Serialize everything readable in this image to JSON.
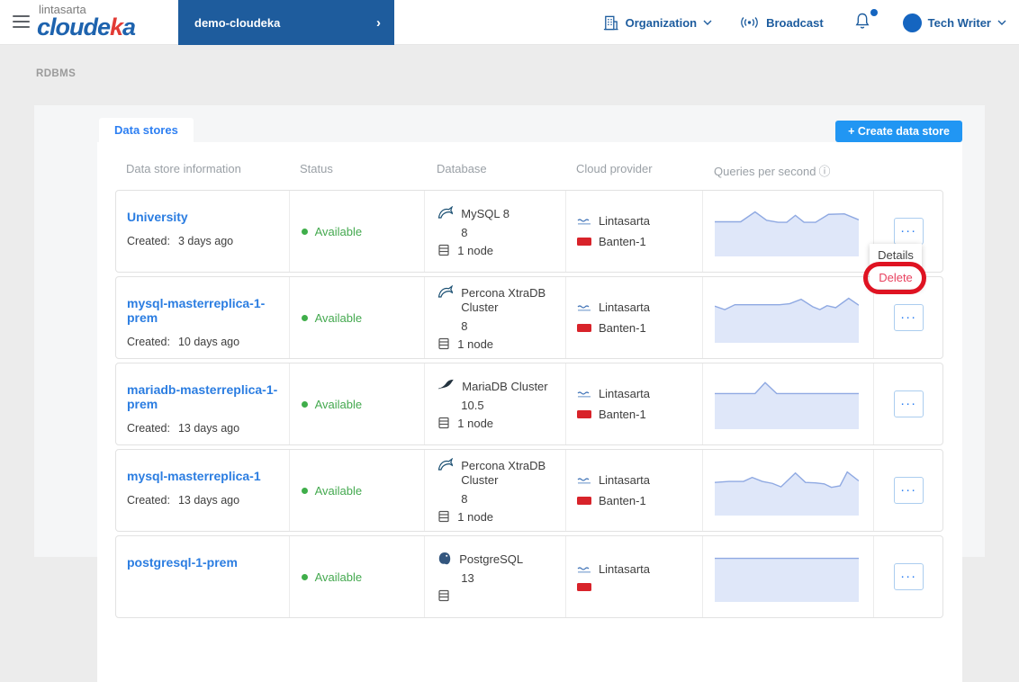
{
  "header": {
    "brand": {
      "sub": "lintasarta",
      "part1": "cloude",
      "part2": "k",
      "part3": "a"
    },
    "project": {
      "label": "demo-cloudeka",
      "chevron": "›"
    },
    "organization_label": "Organization",
    "broadcast_label": "Broadcast",
    "user_name": "Tech Writer"
  },
  "breadcrumb": "RDBMS",
  "tab_label": "Data stores",
  "create_button_label": "+ Create data store",
  "icons": {
    "info": "ⓘ",
    "ellipsis": "···"
  },
  "colors": {
    "accent_blue": "#2196f3",
    "link_blue": "#2b7de1",
    "navy": "#1d5c9e",
    "status_green": "#44a94f",
    "danger_red": "#e8425f",
    "annotation_red": "#df1322",
    "spark_fill": "#dfe7f9",
    "spark_stroke": "#8fa9e2"
  },
  "table": {
    "columns": [
      "Data store information",
      "Status",
      "Database",
      "Cloud provider",
      "Queries per second"
    ],
    "rows": [
      {
        "name": "University",
        "created_label": "Created:",
        "created": "3 days ago",
        "status": "Available",
        "engine": "MySQL 8",
        "version": "8",
        "nodes": "1 node",
        "provider": "Lintasarta",
        "region": "Banten-1",
        "sparkline": [
          [
            0,
            30
          ],
          [
            10,
            30
          ],
          [
            18,
            30
          ],
          [
            28,
            10
          ],
          [
            36,
            27
          ],
          [
            44,
            31
          ],
          [
            50,
            31
          ],
          [
            56,
            17
          ],
          [
            62,
            31
          ],
          [
            70,
            31
          ],
          [
            79,
            15
          ],
          [
            90,
            14
          ],
          [
            100,
            26
          ]
        ]
      },
      {
        "name": "mysql-masterreplica-1-prem",
        "created_label": "Created:",
        "created": "10 days ago",
        "status": "Available",
        "engine": "Percona XtraDB Cluster",
        "version": "8",
        "nodes": "1 node",
        "provider": "Lintasarta",
        "region": "Banten-1",
        "sparkline": [
          [
            0,
            26
          ],
          [
            7,
            33
          ],
          [
            14,
            23
          ],
          [
            30,
            23
          ],
          [
            45,
            23
          ],
          [
            52,
            21
          ],
          [
            60,
            12
          ],
          [
            68,
            27
          ],
          [
            73,
            33
          ],
          [
            78,
            25
          ],
          [
            84,
            29
          ],
          [
            93,
            10
          ],
          [
            100,
            24
          ]
        ]
      },
      {
        "name": "mariadb-masterreplica-1-prem",
        "created_label": "Created:",
        "created": "13 days ago",
        "status": "Available",
        "engine": "MariaDB Cluster",
        "version": "10.5",
        "nodes": "1 node",
        "provider": "Lintasarta",
        "region": "Banten-1",
        "sparkline": [
          [
            0,
            28
          ],
          [
            28,
            28
          ],
          [
            35,
            6
          ],
          [
            43,
            28
          ],
          [
            60,
            28
          ],
          [
            80,
            28
          ],
          [
            100,
            28
          ]
        ]
      },
      {
        "name": "mysql-masterreplica-1",
        "created_label": "Created:",
        "created": "13 days ago",
        "status": "Available",
        "engine": "Percona XtraDB Cluster",
        "version": "8",
        "nodes": "1 node",
        "provider": "Lintasarta",
        "region": "Banten-1",
        "sparkline": [
          [
            0,
            33
          ],
          [
            10,
            31
          ],
          [
            20,
            31
          ],
          [
            26,
            23
          ],
          [
            33,
            31
          ],
          [
            40,
            35
          ],
          [
            46,
            42
          ],
          [
            56,
            14
          ],
          [
            63,
            33
          ],
          [
            70,
            34
          ],
          [
            76,
            36
          ],
          [
            81,
            43
          ],
          [
            87,
            40
          ],
          [
            92,
            12
          ],
          [
            100,
            30
          ]
        ]
      },
      {
        "name": "postgresql-1-prem",
        "created_label": "",
        "created": "",
        "status": "Available",
        "engine": "PostgreSQL",
        "version": "13",
        "nodes": "",
        "provider": "Lintasarta",
        "region": "",
        "sparkline": [
          [
            0,
            12
          ],
          [
            100,
            12
          ]
        ]
      }
    ]
  },
  "action_menu": {
    "items": [
      {
        "label": "Details"
      },
      {
        "label": "Delete"
      }
    ]
  }
}
